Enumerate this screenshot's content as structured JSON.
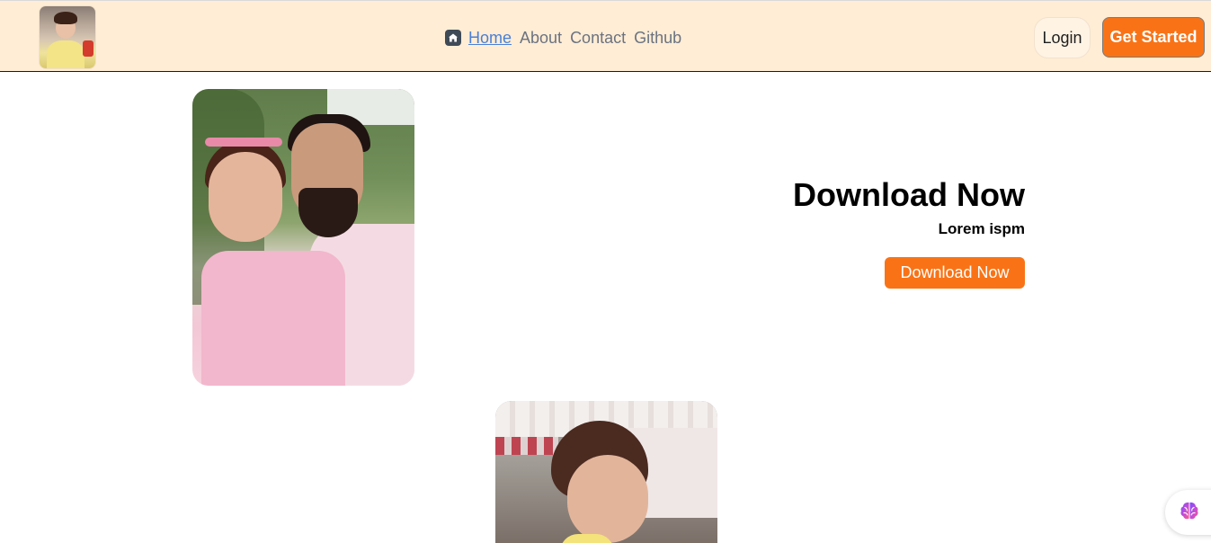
{
  "nav": {
    "links": [
      {
        "label": "Home",
        "active": true
      },
      {
        "label": "About",
        "active": false
      },
      {
        "label": "Contact",
        "active": false
      },
      {
        "label": "Github",
        "active": false
      }
    ],
    "home_icon": "home-icon",
    "login_label": "Login",
    "get_started_label": "Get Started"
  },
  "hero": {
    "title": "Download Now",
    "subtitle": "Lorem ispm",
    "button_label": "Download Now"
  },
  "widget": {
    "icon": "brain-icon"
  },
  "colors": {
    "navbar_bg": "#ffedd5",
    "accent": "#f97316",
    "active_link": "#4a7fd6",
    "muted_link": "#6b7280"
  }
}
